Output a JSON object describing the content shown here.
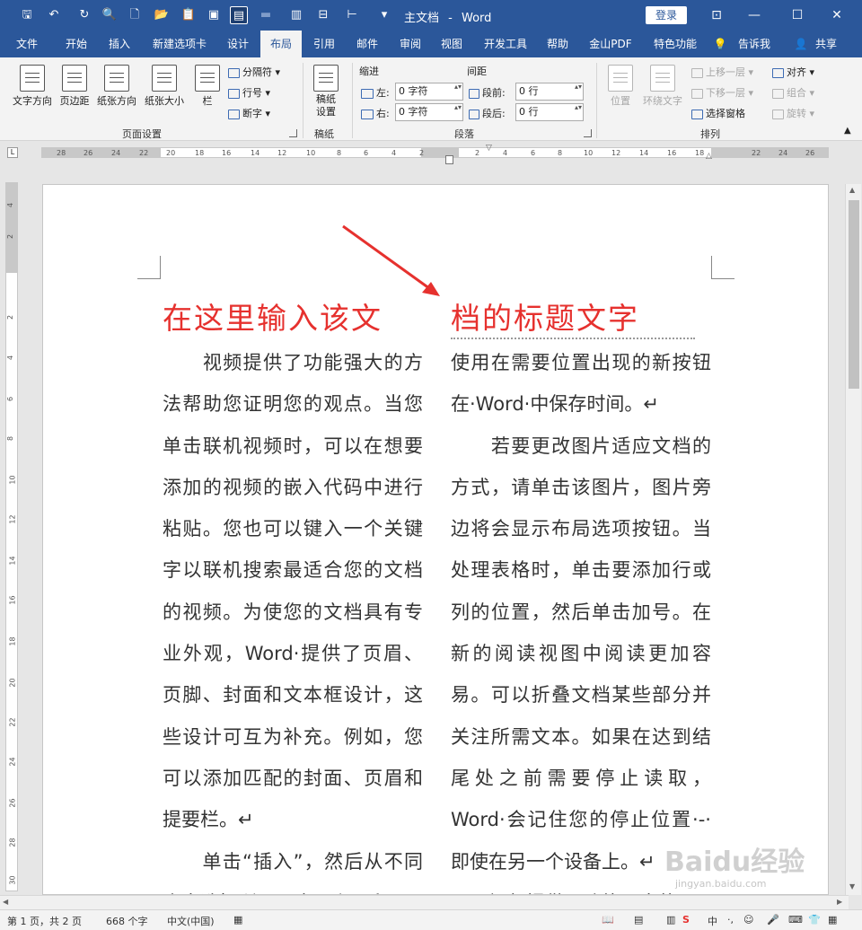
{
  "window": {
    "doc_title": "主文档",
    "app": "Word",
    "title_sep": "-",
    "login": "登录"
  },
  "quick_access": [
    "save-icon",
    "undo-icon",
    "redo-icon",
    "print-preview-icon",
    "new-icon",
    "open-icon",
    "paste-icon",
    "screenshot-icon",
    "page-view-icon",
    "cards-icon",
    "columns-icon",
    "margins-icon",
    "customize-icon"
  ],
  "tabs": [
    "文件",
    "开始",
    "插入",
    "新建选项卡",
    "设计",
    "布局",
    "引用",
    "邮件",
    "审阅",
    "视图",
    "开发工具",
    "帮助",
    "金山PDF",
    "特色功能",
    "告诉我",
    "共享"
  ],
  "active_tab": "布局",
  "ribbon": {
    "page_setup": {
      "label": "页面设置",
      "text_direction": "文字方向",
      "margins": "页边距",
      "orientation": "纸张方向",
      "size": "纸张大小",
      "columns": "栏",
      "breaks": "分隔符",
      "line_numbers": "行号",
      "hyphenation": "断字"
    },
    "manuscript": {
      "label": "稿纸",
      "setting": "稿纸\n设置"
    },
    "paragraph": {
      "label": "段落",
      "indent": "缩进",
      "spacing": "间距",
      "left": "左:",
      "right": "右:",
      "before": "段前:",
      "after": "段后:",
      "left_val": "0 字符",
      "right_val": "0 字符",
      "before_val": "0 行",
      "after_val": "0 行"
    },
    "arrange": {
      "label": "排列",
      "position": "位置",
      "wrap": "环绕文字",
      "forward": "上移一层",
      "backward": "下移一层",
      "selection_pane": "选择窗格",
      "align": "对齐",
      "group": "组合",
      "rotate": "旋转"
    }
  },
  "ruler_h": [
    "28",
    "26",
    "24",
    "22",
    "20",
    "18",
    "16",
    "14",
    "12",
    "10",
    "8",
    "6",
    "4",
    "2",
    "2",
    "4",
    "6",
    "8",
    "10",
    "12",
    "14",
    "16",
    "18",
    "22",
    "24",
    "26"
  ],
  "ruler_v": [
    "4",
    "2",
    "2",
    "4",
    "6",
    "8",
    "10",
    "12",
    "14",
    "16",
    "18",
    "20",
    "22",
    "24",
    "26",
    "28",
    "30"
  ],
  "document": {
    "title_left": "在这里输入该文",
    "title_right": "档的标题文字",
    "col1": [
      "　　视频提供了功能强大的方法帮助您证明您的观点。当您单击联机视频时，可以在想要添加的视频的嵌入代码中进行粘贴。您也可以键入一个关键字以联机搜索最适合您的文档的视频。为使您的文档具有专业外观，Word·提供了页眉、页脚、封面和文本框设计，这些设计可互为补充。例如，您可以添加匹配的封面、页眉和提要栏。↵",
      "　　单击“插入”，然后从不同库中选择所需元素。主题和"
    ],
    "col2": [
      "使用在需要位置出现的新按钮在·Word·中保存时间。↵",
      "　　若要更改图片适应文档的方式，请单击该图片，图片旁边将会显示布局选项按钮。当处理表格时，单击要添加行或列的位置，然后单击加号。在新的阅读视图中阅读更加容易。可以折叠文档某些部分并关注所需文本。如果在达到结尾处之前需要停止读取，Word·会记住您的停止位置·-·即使在另一个设备上。↵",
      "　　视频提供了功能强大的"
    ]
  },
  "status": {
    "page": "第 1 页，共 2 页",
    "words": "668 个字",
    "lang": "中文(中国)",
    "ime": "中"
  },
  "watermark": {
    "brand": "Baidu经验",
    "url": "jingyan.baidu.com"
  }
}
